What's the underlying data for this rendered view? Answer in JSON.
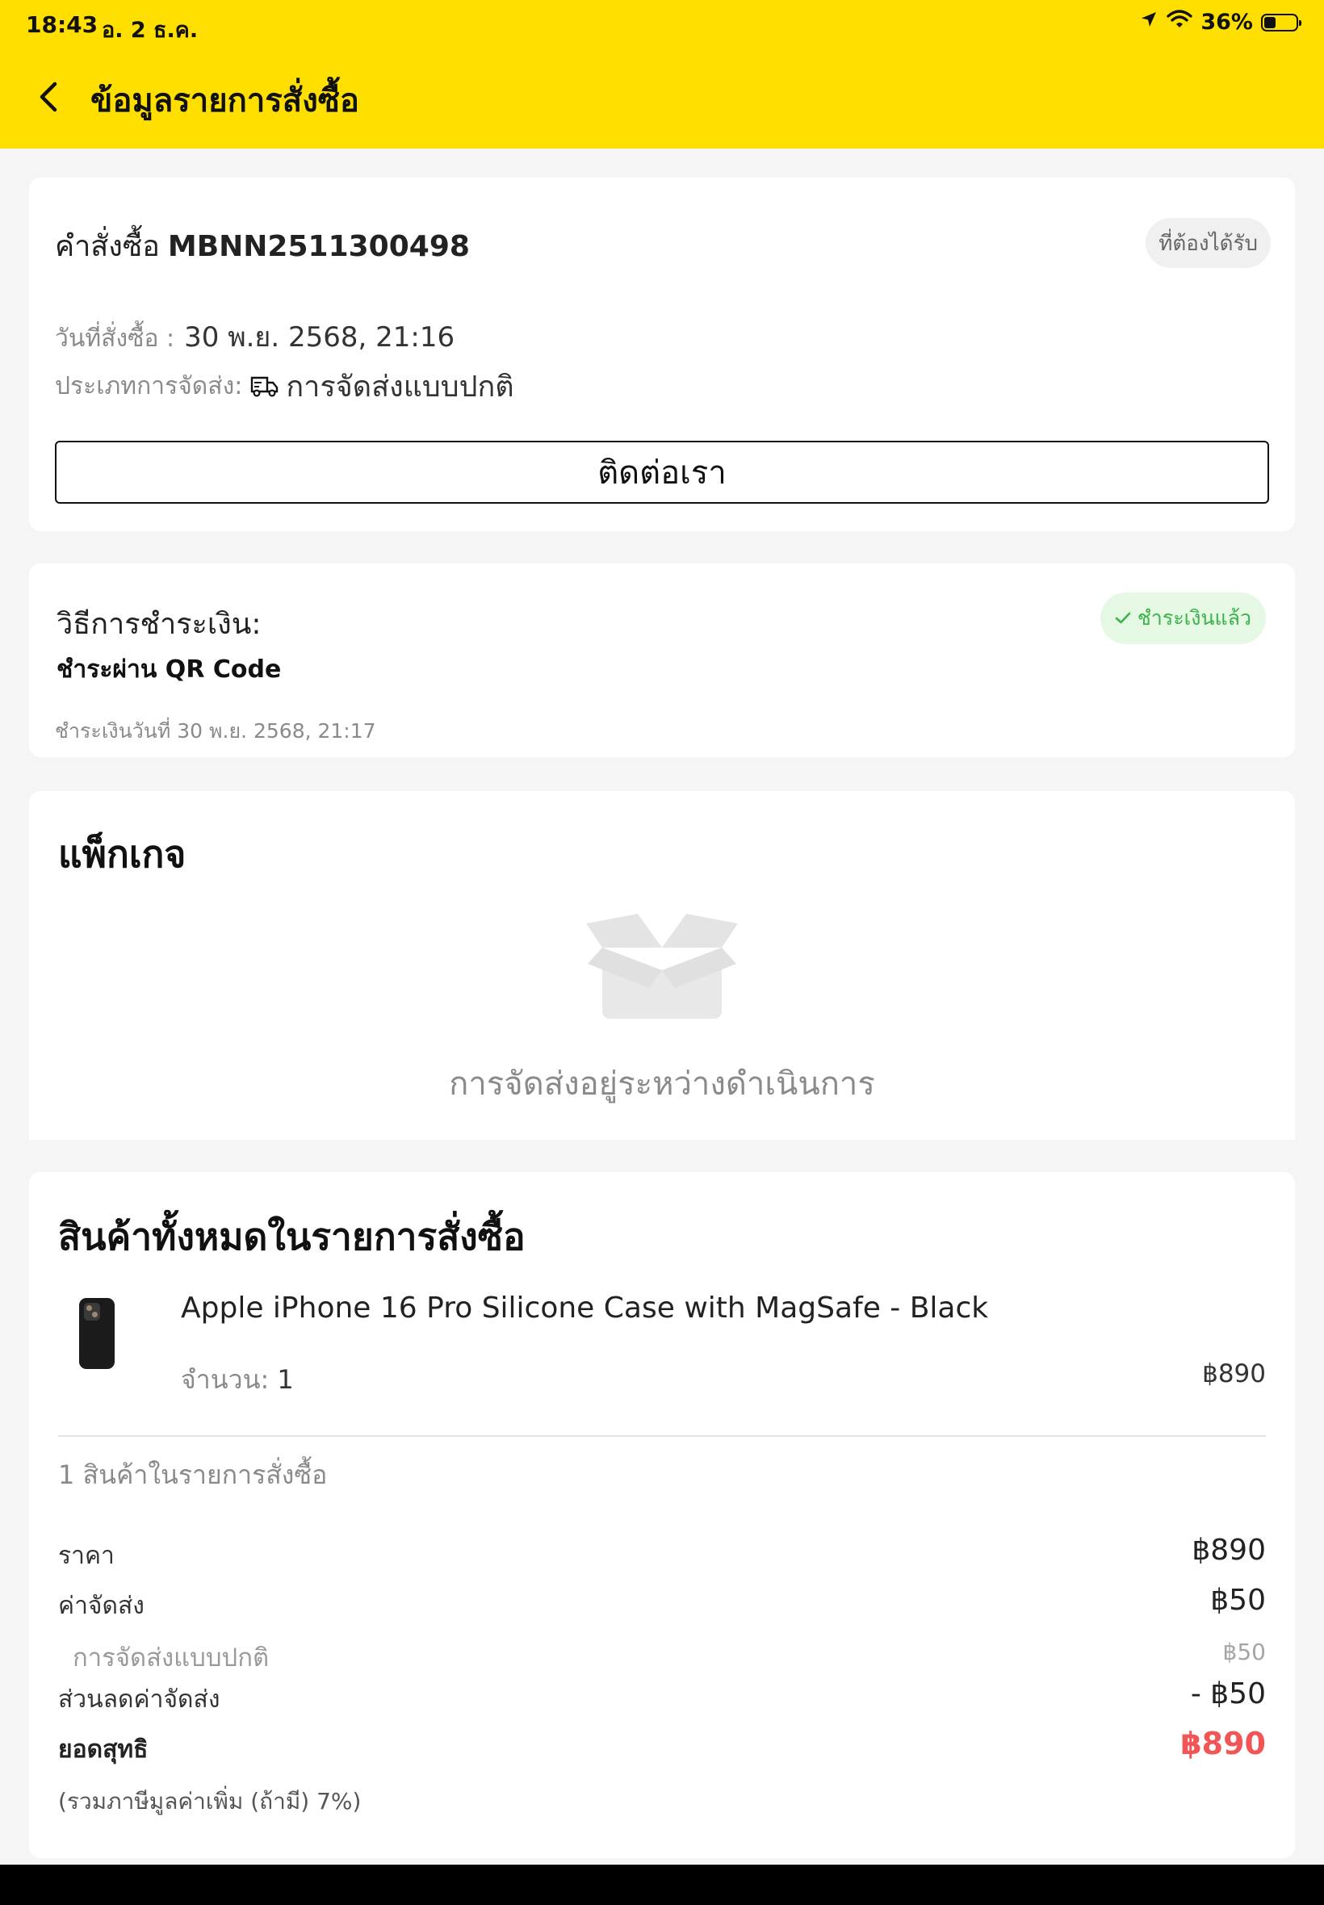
{
  "status_bar": {
    "time": "18:43",
    "date": "อ. 2 ธ.ค.",
    "battery": "36%",
    "battery_level": 0.36
  },
  "header": {
    "title": "ข้อมูลรายการสั่งซื้อ",
    "back_icon": "chevron-left-icon"
  },
  "order": {
    "label": "คำสั่งซื้อ",
    "number": "MBNN2511300498",
    "status": "ที่ต้องได้รับ",
    "date_label": "วันที่สั่งซื้อ :",
    "date_value": "30 พ.ย. 2568, 21:16",
    "shipping_label": "ประเภทการจัดส่ง:",
    "shipping_value": "การจัดส่งแบบปกติ",
    "contact_button": "ติดต่อเรา"
  },
  "payment": {
    "label": "วิธีการชำระเงิน:",
    "method": "ชำระผ่าน QR Code",
    "status": "ชำระเงินแล้ว",
    "paid_date": "ชำระเงินวันที่ 30 พ.ย. 2568, 21:17"
  },
  "package": {
    "title": "แพ็กเกจ",
    "status": "การจัดส่งอยู่ระหว่างดำเนินการ"
  },
  "items": {
    "title": "สินค้าทั้งหมดในรายการสั่งซื้อ",
    "list": [
      {
        "name": "Apple iPhone 16 Pro Silicone Case with MagSafe - Black",
        "qty_label": "จำนวน:",
        "qty": "1",
        "price": "฿890"
      }
    ],
    "count_text": "1 สินค้าในรายการสั่งซื้อ"
  },
  "summary": {
    "price_label": "ราคา",
    "price_value": "฿890",
    "shipping_label": "ค่าจัดส่ง",
    "shipping_value": "฿50",
    "shipping_sub_label": "การจัดส่งแบบปกติ",
    "shipping_sub_value": "฿50",
    "discount_label": "ส่วนลดค่าจัดส่ง",
    "discount_value": "- ฿50",
    "net_label": "ยอดสุทธิ",
    "net_value": "฿890",
    "vat_note": "(รวมภาษีมูลค่าเพิ่ม (ถ้ามี) 7%)"
  },
  "colors": {
    "header_bg": "#ffdf00",
    "paid_green": "#3cb34a",
    "paid_bg": "#e4f8e4",
    "net_red": "#f25555"
  }
}
